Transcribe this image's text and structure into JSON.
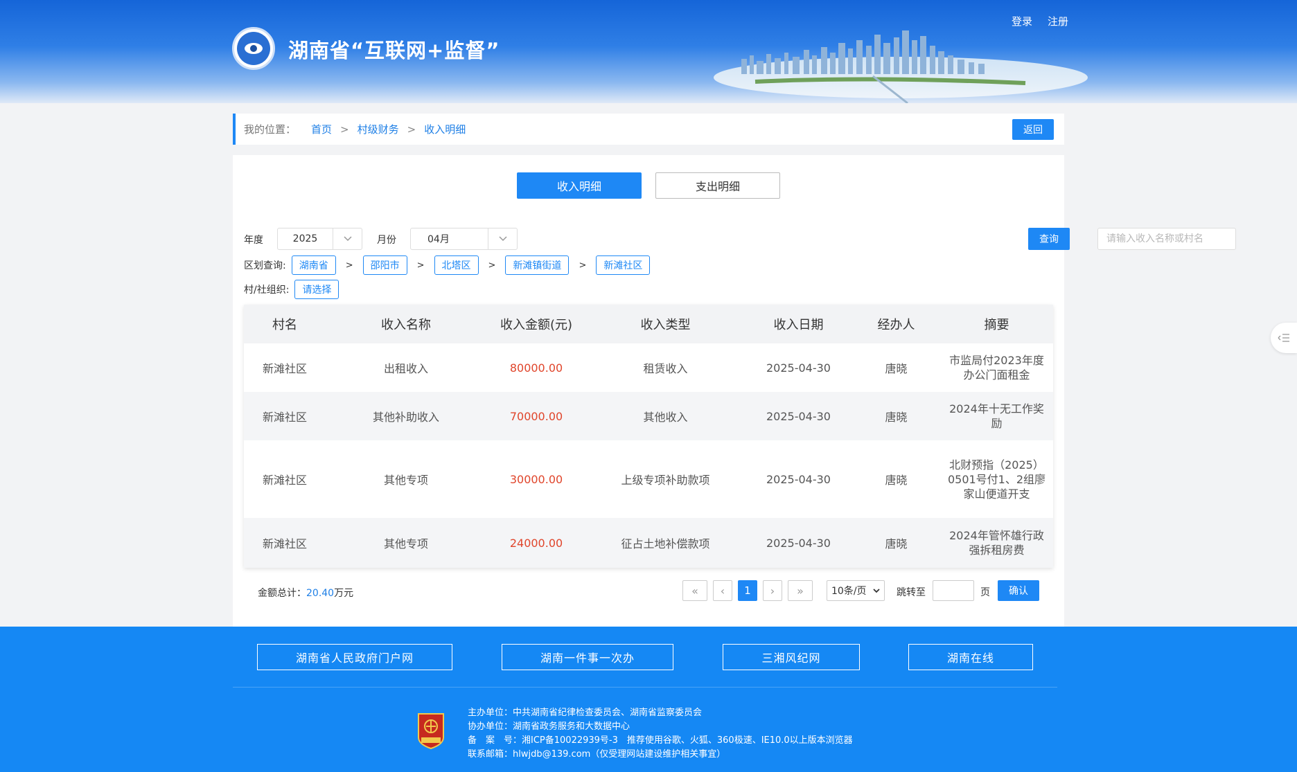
{
  "header": {
    "title": "湖南省“互联网+监督”",
    "login": "登录",
    "register": "注册"
  },
  "breadcrumb": {
    "label": "我的位置：",
    "items": [
      "首页",
      "村级财务",
      "收入明细"
    ],
    "sep": ">",
    "back": "返回"
  },
  "tabs": [
    {
      "label": "收入明细",
      "active": true
    },
    {
      "label": "支出明细",
      "active": false
    }
  ],
  "filters": {
    "year_label": "年度",
    "year_value": "2025",
    "month_label": "月份",
    "month_value": "04月",
    "search_placeholder": "请输入收入名称或村名",
    "query_label": "查询",
    "region_label": "区划查询:",
    "regions": [
      "湖南省",
      "邵阳市",
      "北塔区",
      "新滩镇街道",
      "新滩社区"
    ],
    "region_sep": ">",
    "org_label": "村/社组织:",
    "org_value": "请选择"
  },
  "table": {
    "headers": [
      "村名",
      "收入名称",
      "收入金额(元)",
      "收入类型",
      "收入日期",
      "经办人",
      "摘要"
    ],
    "rows": [
      {
        "village": "新滩社区",
        "name": "出租收入",
        "amount": "80000.00",
        "type": "租赁收入",
        "date": "2025-04-30",
        "handler": "唐晓",
        "summary": "市监局付2023年度办公门面租金"
      },
      {
        "village": "新滩社区",
        "name": "其他补助收入",
        "amount": "70000.00",
        "type": "其他收入",
        "date": "2025-04-30",
        "handler": "唐晓",
        "summary": "2024年十无工作奖励"
      },
      {
        "village": "新滩社区",
        "name": "其他专项",
        "amount": "30000.00",
        "type": "上级专项补助款项",
        "date": "2025-04-30",
        "handler": "唐晓",
        "summary": "北财预指（2025）0501号付1、2组廖家山便道开支"
      },
      {
        "village": "新滩社区",
        "name": "其他专项",
        "amount": "24000.00",
        "type": "征占土地补偿款项",
        "date": "2025-04-30",
        "handler": "唐晓",
        "summary": "2024年管怀雄行政强拆租房费"
      }
    ]
  },
  "summary": {
    "total_label": "金额总计：",
    "total_value": "20.40",
    "total_unit": "万元"
  },
  "pagination": {
    "first": "«",
    "prev": "‹",
    "current": "1",
    "next": "›",
    "last": "»",
    "per_page": "10条/页",
    "jump_label": "跳转至",
    "page_label": "页",
    "confirm": "确认"
  },
  "footer": {
    "links": [
      "湖南省人民政府门户网",
      "湖南一件事一次办",
      "三湘风纪网",
      "湖南在线"
    ],
    "host": "主办单位：中共湖南省纪律检查委员会、湖南省监察委员会",
    "co_host": "协办单位：湖南省政务服务和大数据中心",
    "icp": "备　案　号：湘ICP备10022939号-3　推荐使用谷歌、火狐、360极速、IE10.0以上版本浏览器",
    "email": "联系邮箱：hlwjdb@139.com（仅受理网站建设维护相关事宜）",
    "badge_text": "党政机关"
  },
  "colors": {
    "primary": "#1e88f5",
    "amount": "#e0452b",
    "footer_bg": "#1588f4"
  }
}
